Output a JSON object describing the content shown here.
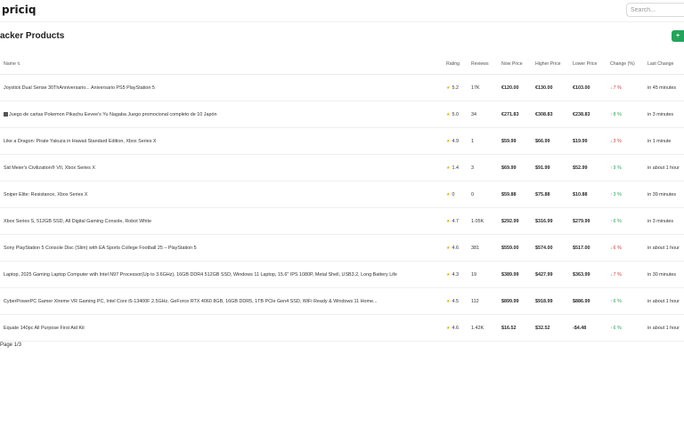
{
  "app": {
    "brand": "priciq"
  },
  "search": {
    "placeholder": "Search..."
  },
  "page": {
    "title": "acker Products",
    "add_label": "+ "
  },
  "table": {
    "headers": {
      "name": "Name",
      "rating": "Rating",
      "reviews": "Reviews",
      "now_price": "Now Price",
      "higher_price": "Higher Price",
      "lower_price": "Lower Price",
      "change": "Change (%)",
      "last_change": "Last Change"
    },
    "rows": [
      {
        "name": "Joystick Dual Sense 30ThAnniversario... Aniversario PS5 PlayStation 5",
        "rating": "5.2",
        "reviews": "17K",
        "now": "€120.00",
        "high": "€130.00",
        "low": "€103.00",
        "change": "7 %",
        "dir": "down",
        "last": "in 45 minutes"
      },
      {
        "name": "Juego de cartas Pokemon Pikachu Eevee's Yu Nagaba Juego promocional completo de 10 Japón",
        "rating": "5.0",
        "reviews": "34",
        "now": "€271.83",
        "high": "€308.83",
        "low": "€238.83",
        "change": "8 %",
        "dir": "up",
        "last": "in 3 minutes"
      },
      {
        "name": "Like a Dragon: Pirate Yakuza in Hawaii Standard Edition, Xbox Series X",
        "rating": "4.9",
        "reviews": "1",
        "now": "$59.99",
        "high": "$66.99",
        "low": "$19.99",
        "change": "3 %",
        "dir": "down",
        "last": "in 1 minute"
      },
      {
        "name": "Sid Meier's Civilization® VII, Xbox Series X",
        "rating": "1.4",
        "reviews": "3",
        "now": "$69.99",
        "high": "$91.99",
        "low": "$52.99",
        "change": "9 %",
        "dir": "up",
        "last": "in about 1 hour"
      },
      {
        "name": "Sniper Elite: Resistance, Xbox Series X",
        "rating": "0",
        "reviews": "0",
        "now": "$59.88",
        "high": "$75.88",
        "low": "$10.88",
        "change": "3 %",
        "dir": "up",
        "last": "in 39 minutes"
      },
      {
        "name": "Xbox Series S, 512GB SSD, All Digital Gaming Console, Robot White",
        "rating": "4.7",
        "reviews": "1.05K",
        "now": "$292.99",
        "high": "$316.99",
        "low": "$279.99",
        "change": "6 %",
        "dir": "up",
        "last": "in 3 minutes"
      },
      {
        "name": "Sony PlayStation 5 Console Disc (Slim) with EA Sports College Football 25 – PlayStation 5",
        "rating": "4.6",
        "reviews": "381",
        "now": "$559.00",
        "high": "$574.00",
        "low": "$517.00",
        "change": "6 %",
        "dir": "down",
        "last": "in about 1 hour"
      },
      {
        "name": "Laptop, 2025 Gaming Laptop Computer with Intel N97 Processor(Up to 3.6GHz), 16GB DDR4 512GB SSD, Windows 11 Laptop, 15.6\" IPS 1080P, Metal Shell, USB3.2, Long Battery Life",
        "rating": "4.3",
        "reviews": "19",
        "now": "$389.99",
        "high": "$427.99",
        "low": "$363.99",
        "change": "7 %",
        "dir": "down",
        "last": "in 30 minutes"
      },
      {
        "name": "CyberPowerPC Gamer Xtreme VR Gaming PC, Intel Core i5-13400F 2.5GHz, GeForce RTX 4060 8GB, 16GB DDR5, 1TB PCIe Gen4 SSD, WiFi Ready & Windows 11 Home...",
        "rating": "4.5",
        "reviews": "112",
        "now": "$899.99",
        "high": "$918.99",
        "low": "$886.99",
        "change": "6 %",
        "dir": "up",
        "last": "in about 1 hour"
      },
      {
        "name": "Equate 140pc All Purpose First Aid Kit",
        "rating": "4.6",
        "reviews": "1.42K",
        "now": "$16.52",
        "high": "$32.52",
        "low": "-$4.48",
        "change": "6 %",
        "dir": "up",
        "last": "in about 1 hour"
      }
    ]
  },
  "pagination": {
    "label": "Page 1/3"
  },
  "colors": {
    "accent": "#22a55a",
    "up": "#2aa35a",
    "down": "#d23b3b",
    "star": "#e8b400"
  }
}
